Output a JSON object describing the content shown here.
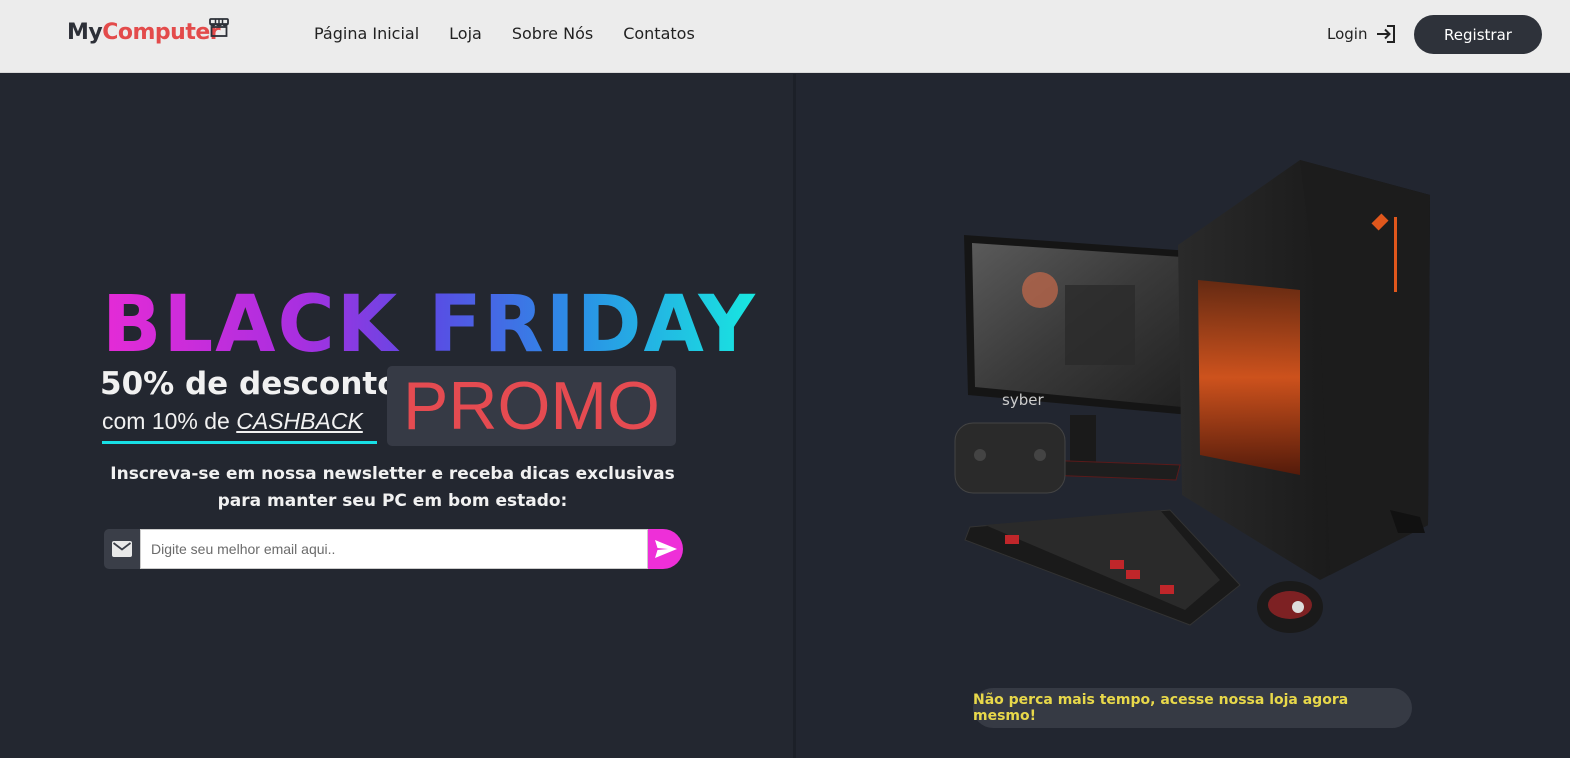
{
  "header": {
    "logo_my": "My",
    "logo_computer": "Computer",
    "nav": [
      "Página Inicial",
      "Loja",
      "Sobre Nós",
      "Contatos"
    ],
    "login_label": "Login",
    "register_label": "Registrar"
  },
  "hero": {
    "title": "BLACK FRIDAY",
    "discount": "50% de desconto",
    "cashback_prefix": "com 10% de ",
    "cashback_word": "CASHBACK",
    "promo": "PROMO",
    "newsletter_line1": "Inscreva-se em nossa newsletter e receba dicas exclusivas",
    "newsletter_line2": "para manter seu PC em bom estado:",
    "email_placeholder": "Digite seu melhor email aqui..",
    "product_brand": "syber"
  },
  "cta": {
    "label": "Não perca mais tempo, acesse nossa loja agora mesmo!"
  },
  "colors": {
    "accent_red": "#e34b4b",
    "accent_pink": "#ee2fd8",
    "accent_cyan": "#18e0e6",
    "cta_text": "#e8d84a",
    "background": "#222630"
  },
  "icons": [
    "store-icon",
    "login-arrow-icon",
    "mail-icon",
    "send-icon"
  ]
}
